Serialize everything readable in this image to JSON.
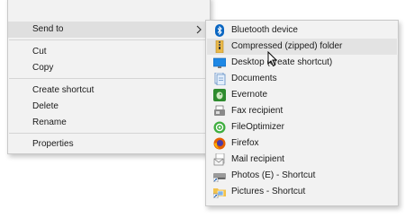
{
  "main_menu": {
    "items": [
      {
        "label": "Send to",
        "has_submenu": true,
        "highlighted": true
      },
      {
        "label": "Cut"
      },
      {
        "label": "Copy"
      },
      {
        "label": "Create shortcut"
      },
      {
        "label": "Delete"
      },
      {
        "label": "Rename"
      },
      {
        "label": "Properties"
      }
    ]
  },
  "send_to_menu": {
    "items": [
      {
        "label": "Bluetooth device",
        "icon": "bluetooth-icon"
      },
      {
        "label": "Compressed (zipped) folder",
        "icon": "zip-folder-icon",
        "highlighted": true
      },
      {
        "label": "Desktop (create shortcut)",
        "icon": "desktop-icon"
      },
      {
        "label": "Documents",
        "icon": "documents-icon"
      },
      {
        "label": "Evernote",
        "icon": "evernote-icon"
      },
      {
        "label": "Fax recipient",
        "icon": "fax-icon"
      },
      {
        "label": "FileOptimizer",
        "icon": "fileoptimizer-icon"
      },
      {
        "label": "Firefox",
        "icon": "firefox-icon"
      },
      {
        "label": "Mail recipient",
        "icon": "mail-icon"
      },
      {
        "label": "Photos (E) - Shortcut",
        "icon": "photos-shortcut-icon"
      },
      {
        "label": "Pictures - Shortcut",
        "icon": "pictures-shortcut-icon"
      }
    ]
  },
  "colors": {
    "menu_bg": "#f2f2f2",
    "highlight": "#dfdfdf",
    "bluetooth": "#0a66c2",
    "zip": "#e8b84a",
    "evernote": "#2e8b2e",
    "firefox": "#e66000"
  }
}
